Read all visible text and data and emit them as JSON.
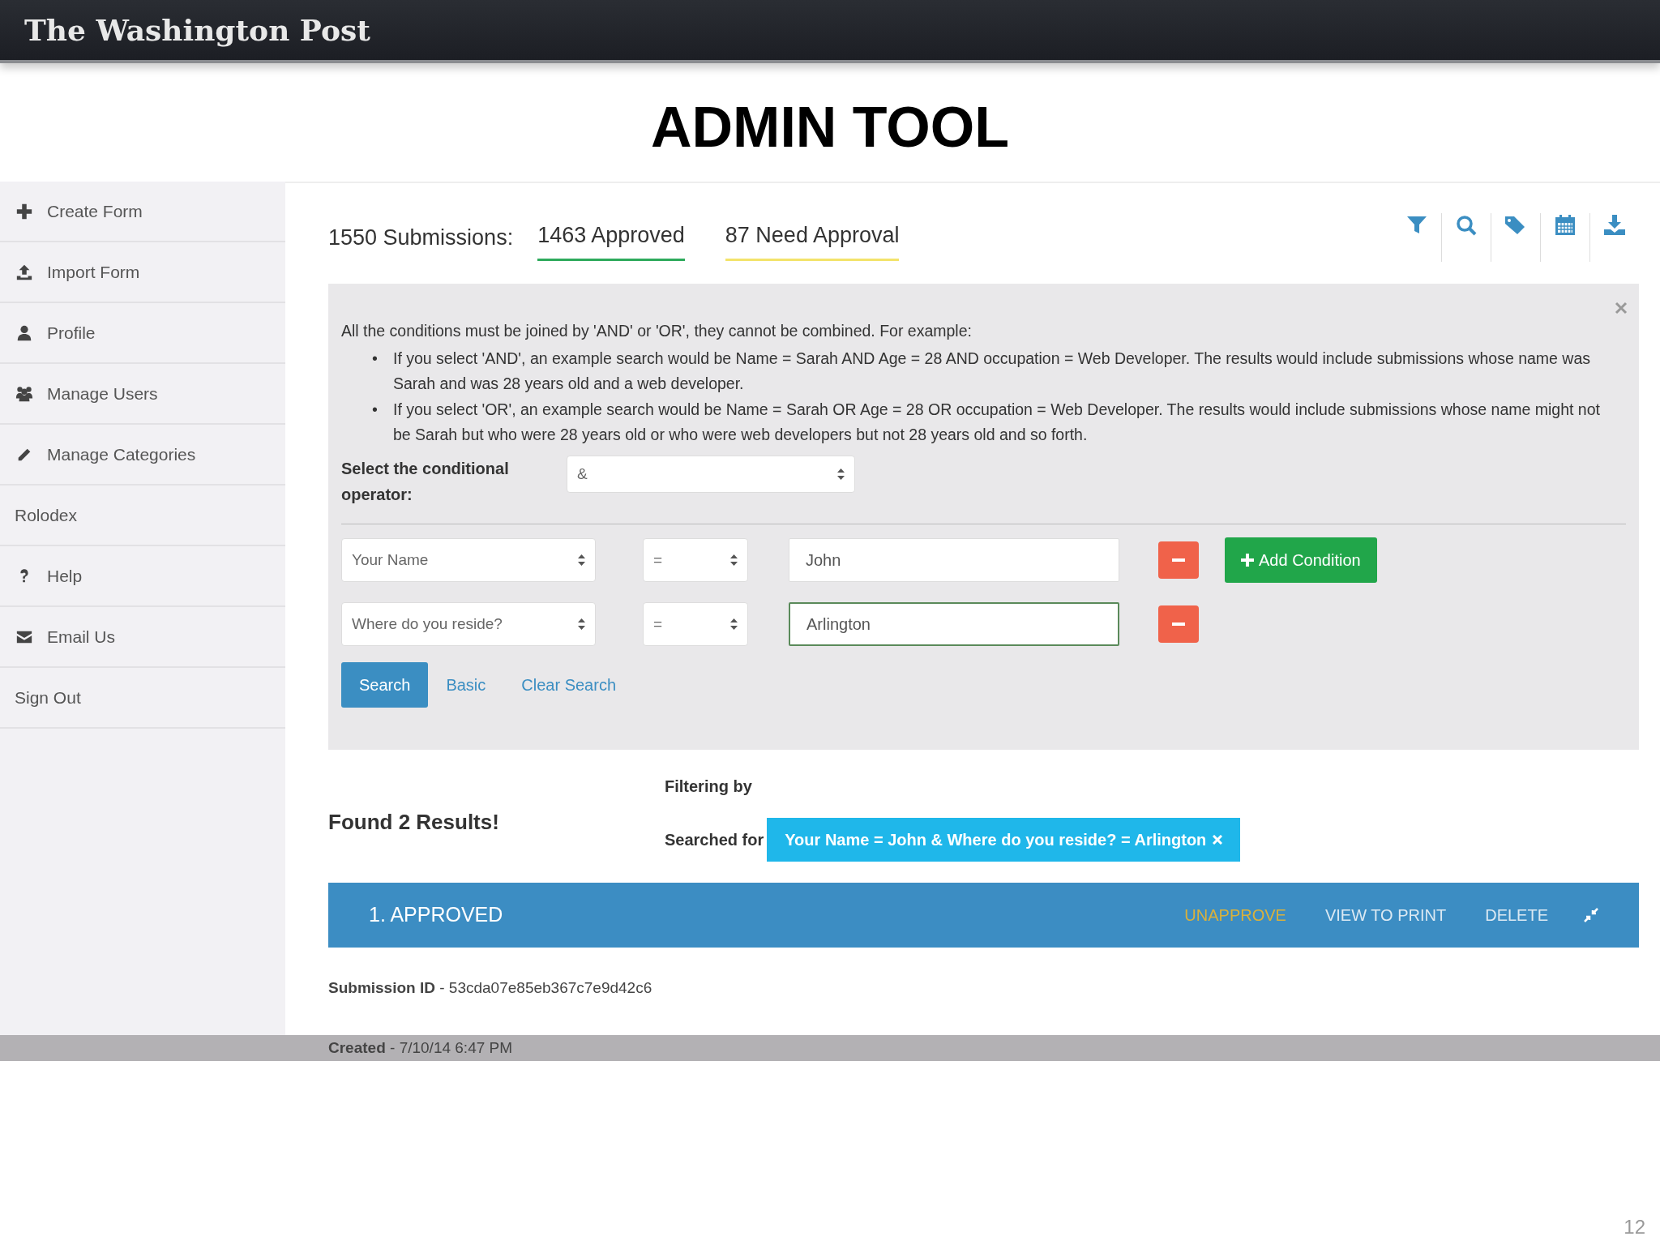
{
  "header": {
    "logo": "The Washington Post"
  },
  "slide_title": "ADMIN TOOL",
  "sidebar": {
    "items": [
      {
        "label": "Create Form",
        "has_icon": true
      },
      {
        "label": "Import Form",
        "has_icon": true
      },
      {
        "label": "Profile",
        "has_icon": true
      },
      {
        "label": "Manage Users",
        "has_icon": true
      },
      {
        "label": "Manage Categories",
        "has_icon": true
      },
      {
        "label": "Rolodex",
        "has_icon": false
      },
      {
        "label": "Help",
        "has_icon": true
      },
      {
        "label": "Email Us",
        "has_icon": true
      },
      {
        "label": "Sign Out",
        "has_icon": false
      }
    ]
  },
  "summary": {
    "total": "1550 Submissions:",
    "tabs": [
      {
        "label": "1463 Approved",
        "color": "#2eaa5c"
      },
      {
        "label": "87 Need Approval",
        "color": "#f3e36b"
      }
    ]
  },
  "search_panel": {
    "intro": "All the conditions must be joined by 'AND' or 'OR', they cannot be combined. For example:",
    "examples": [
      {
        "marker": "•",
        "text": "If you select 'AND', an example search would be Name = Sarah AND Age = 28 AND occupation = Web Developer. The results would include submissions whose name was Sarah and was 28 years old and a web developer."
      },
      {
        "marker": "•",
        "text": "If you select 'OR', an example search would be Name = Sarah OR Age = 28 OR occupation = Web Developer. The results would include submissions whose name might not be Sarah but who were 28 years old or who were web developers but not 28 years old and so forth."
      }
    ],
    "operator_label": "Select the conditional operator:",
    "operator_value": "&",
    "conditions": [
      {
        "field": "Your Name",
        "op": "=",
        "value": "John",
        "focused": false
      },
      {
        "field": "Where do you reside?",
        "op": "=",
        "value": "Arlington",
        "focused": true
      }
    ],
    "add_button": "Add Condition",
    "buttons": [
      {
        "label": "Search",
        "kind": "primary"
      },
      {
        "label": "Basic",
        "kind": "link"
      },
      {
        "label": "Clear Search",
        "kind": "link"
      }
    ]
  },
  "results": {
    "found": "Found 2 Results!",
    "filtering_label": "Filtering by",
    "searched_label": "Searched for",
    "query": "Your Name = John & Where do you reside? = Arlington"
  },
  "submission": {
    "title": "1. APPROVED",
    "actions": [
      {
        "label": "UNAPPROVE",
        "kind": "warning"
      },
      {
        "label": "VIEW TO PRINT",
        "kind": "plain"
      },
      {
        "label": "DELETE",
        "kind": "plain"
      }
    ],
    "id_line": "**Submission ID** - 53cda07e85eb367c7e9d42c6",
    "created_line": "**Created** - 7/10/14 6:47 PM"
  },
  "page_number": "12"
}
